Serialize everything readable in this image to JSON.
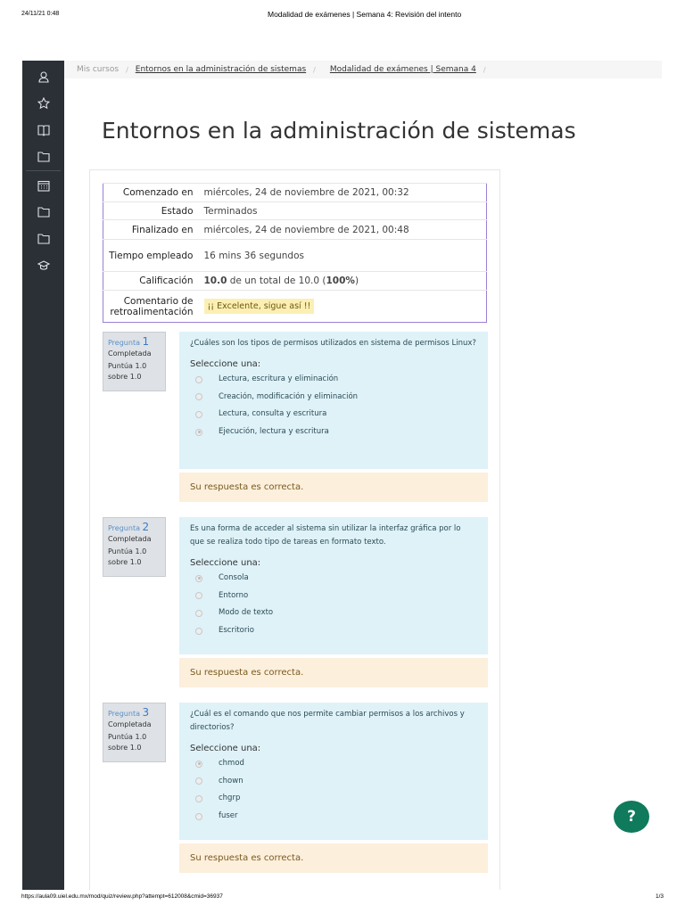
{
  "print_header": {
    "datetime": "24/11/21 0:48",
    "title": "Modalidad de exámenes | Semana 4: Revisión del intento"
  },
  "print_footer": {
    "url": "https://aula09.uiel.edu.mx/mod/quiz/review.php?attempt=612008&cmid=36937",
    "page": "1/3"
  },
  "sidebar": {
    "icons": [
      "user-icon",
      "star-icon",
      "book-icon",
      "folder-icon",
      "calendar-icon",
      "folder-icon",
      "folder-icon",
      "graduation-cap-icon"
    ]
  },
  "breadcrumb": {
    "items": [
      "Mis cursos",
      "Entornos en la administración de sistemas",
      "Modalidad de exámenes | Semana 4"
    ],
    "sep": "/"
  },
  "page_title": "Entornos en la administración de sistemas",
  "summary": [
    {
      "k": "Comenzado en",
      "v": "miércoles, 24 de noviembre de 2021, 00:32"
    },
    {
      "k": "Estado",
      "v": "Terminados"
    },
    {
      "k": "Finalizado en",
      "v": "miércoles, 24 de noviembre de 2021, 00:48"
    },
    {
      "k": "Tiempo empleado",
      "v": "16 mins 36 segundos"
    },
    {
      "k": "Calificación",
      "v_bold": "10.0",
      "v_mid": " de un total de 10.0 (",
      "v_pct": "100%",
      "v_end": ")"
    },
    {
      "k": "Comentario de retroalimentación",
      "v": "¡¡ Excelente, sigue así !!"
    }
  ],
  "questions": [
    {
      "label": "Pregunta",
      "num": "1",
      "state": "Completada",
      "score": "Puntúa 1.0 sobre 1.0",
      "text": "¿Cuáles son los tipos de permisos utilizados en sistema de permisos Linux?",
      "prompt": "Seleccione una:",
      "options": [
        "Lectura, escritura y eliminación",
        "Creación, modificación y eliminación",
        "Lectura, consulta y escritura",
        "Ejecución, lectura y escritura"
      ],
      "selected": 3,
      "feedback": "Su respuesta es correcta."
    },
    {
      "label": "Pregunta",
      "num": "2",
      "state": "Completada",
      "score": "Puntúa 1.0 sobre 1.0",
      "text": "Es una forma de acceder al sistema sin utilizar la interfaz gráfica por lo que se realiza todo tipo de tareas en formato texto.",
      "prompt": "Seleccione una:",
      "options": [
        "Consola",
        "Entorno",
        "Modo de texto",
        "Escritorio"
      ],
      "selected": 0,
      "feedback": "Su respuesta es correcta."
    },
    {
      "label": "Pregunta",
      "num": "3",
      "state": "Completada",
      "score": "Puntúa 1.0 sobre 1.0",
      "text": "¿Cuál es el comando que nos permite cambiar permisos a los archivos y directorios?",
      "prompt": "Seleccione una:",
      "options": [
        "chmod",
        "chown",
        "chgrp",
        "fuser"
      ],
      "selected": 0,
      "feedback": "Su respuesta es correcta."
    }
  ],
  "help_button": "?"
}
